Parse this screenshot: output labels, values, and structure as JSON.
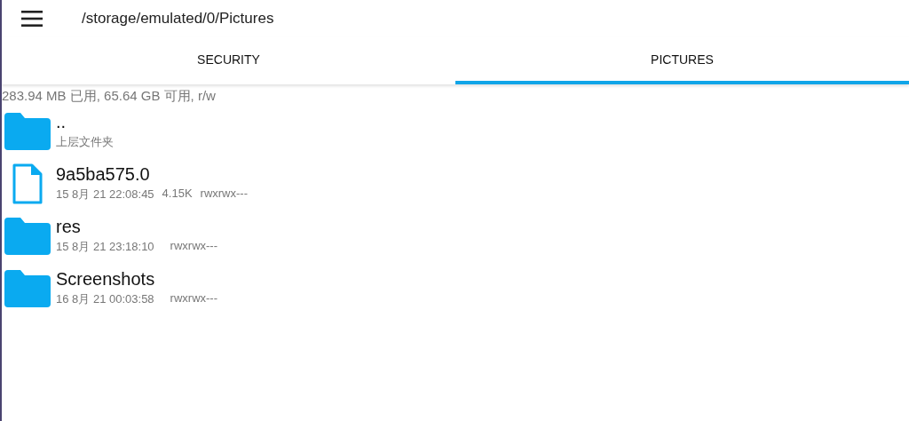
{
  "toolbar": {
    "path": "/storage/emulated/0/Pictures"
  },
  "tabs": [
    {
      "label": "SECURITY",
      "selected": false
    },
    {
      "label": "PICTURES",
      "selected": true
    }
  ],
  "storage_info": "283.94 MB 已用, 65.64 GB 可用, r/w",
  "files": [
    {
      "kind": "parent",
      "name": "..",
      "subtitle": "上层文件夹"
    },
    {
      "kind": "file",
      "name": "9a5ba575.0",
      "date": "15 8月 21 22:08:45",
      "size": "4.15K",
      "permissions": "rwxrwx---"
    },
    {
      "kind": "folder",
      "name": "res",
      "date": "15 8月 21 23:18:10",
      "permissions": "rwxrwx---"
    },
    {
      "kind": "folder",
      "name": "Screenshots",
      "date": "16 8月 21 00:03:58",
      "permissions": "rwxrwx---"
    }
  ]
}
